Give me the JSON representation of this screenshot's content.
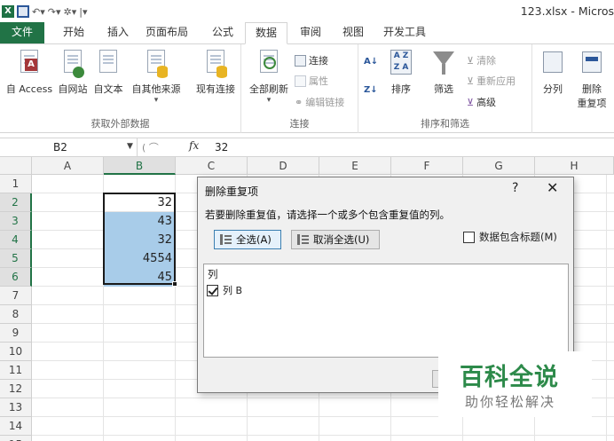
{
  "window": {
    "title": "123.xlsx - Micros"
  },
  "tabs": [
    {
      "label": "文件"
    },
    {
      "label": "开始"
    },
    {
      "label": "插入"
    },
    {
      "label": "页面布局"
    },
    {
      "label": "公式"
    },
    {
      "label": "数据"
    },
    {
      "label": "审阅"
    },
    {
      "label": "视图"
    },
    {
      "label": "开发工具"
    }
  ],
  "ribbon": {
    "external": {
      "access": "自 Access",
      "web": "自网站",
      "text": "自文本",
      "other": "自其他来源",
      "existing": "现有连接",
      "group": "获取外部数据"
    },
    "connections": {
      "refresh": "全部刷新",
      "connections": "连接",
      "properties": "属性",
      "edit_links": "编辑链接",
      "group": "连接"
    },
    "sort_filter": {
      "sort": "排序",
      "filter": "筛选",
      "clear": "清除",
      "reapply": "重新应用",
      "advanced": "高级",
      "group": "排序和筛选"
    },
    "data_tools": {
      "split": "分列",
      "remove": "删除",
      "remove2": "重复项"
    }
  },
  "formula_bar": {
    "name_box": "B2",
    "fx": "fx",
    "value": "32"
  },
  "grid": {
    "columns": [
      "A",
      "B",
      "C",
      "D",
      "E",
      "F",
      "G",
      "H"
    ],
    "rows": [
      "1",
      "2",
      "3",
      "4",
      "5",
      "6",
      "7",
      "8",
      "9",
      "10",
      "11",
      "12",
      "13",
      "14",
      "15"
    ],
    "cells_b": [
      "32",
      "43",
      "32",
      "4554",
      "45"
    ]
  },
  "dialog": {
    "title": "删除重复项",
    "help": "?",
    "close": "✕",
    "prompt": "若要删除重复值，请选择一个或多个包含重复值的列。",
    "select_all": "全选(A)",
    "unselect_all": "取消全选(U)",
    "has_headers": "数据包含标题(M)",
    "list_header": "列",
    "list_items": [
      "列 B"
    ]
  },
  "watermark": {
    "title": "百科全说",
    "subtitle": "助你轻松解决"
  },
  "colors": {
    "accent": "#217346",
    "selection": "#a8cce9",
    "watermark": "#2d8a4a"
  }
}
